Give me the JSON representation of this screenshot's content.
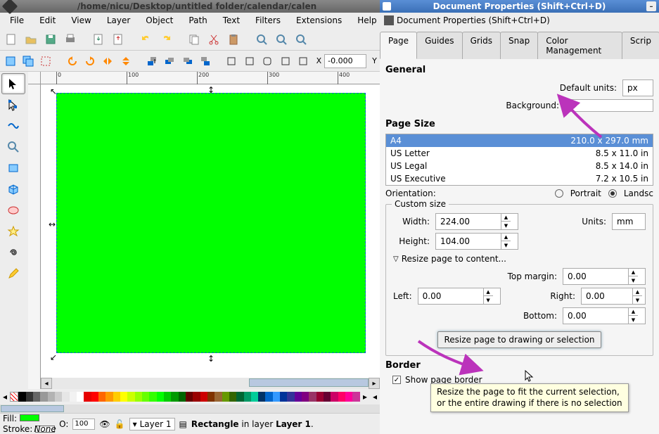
{
  "main_window": {
    "title": "/home/nicu/Desktop/untitled folder/calendar/calen",
    "menu": [
      "File",
      "Edit",
      "View",
      "Layer",
      "Object",
      "Path",
      "Text",
      "Filters",
      "Extensions",
      "Help"
    ],
    "coord_x_label": "X",
    "coord_x_value": "-0.000",
    "coord_y_label": "Y",
    "ruler_ticks": [
      "0",
      "100",
      "200",
      "300",
      "400"
    ]
  },
  "statusbar": {
    "fill_label": "Fill:",
    "stroke_label": "Stroke:",
    "stroke_value": "None",
    "opacity_label": "O:",
    "opacity_value": "100",
    "layer_value": "Layer 1",
    "status_prefix": "Rectangle",
    "status_mid1": " in layer ",
    "status_layer": "Layer 1",
    "status_suffix": ". "
  },
  "dialog": {
    "title": "Document Properties (Shift+Ctrl+D)",
    "subtitle": "Document Properties (Shift+Ctrl+D)",
    "tabs": [
      "Page",
      "Guides",
      "Grids",
      "Snap",
      "Color Management",
      "Scrip"
    ],
    "general_heading": "General",
    "default_units_label": "Default units:",
    "default_units_value": "px",
    "background_label": "Background:",
    "page_size_heading": "Page Size",
    "sizes": [
      {
        "name": "A4",
        "dim": "210.0 x 297.0 mm"
      },
      {
        "name": "US Letter",
        "dim": "8.5 x 11.0 in"
      },
      {
        "name": "US Legal",
        "dim": "8.5 x 14.0 in"
      },
      {
        "name": "US Executive",
        "dim": "7.2 x 10.5 in"
      }
    ],
    "orientation_label": "Orientation:",
    "portrait_label": "Portrait",
    "landscape_label": "Landsc",
    "custom_size_legend": "Custom size",
    "width_label": "Width:",
    "width_value": "224.00",
    "height_label": "Height:",
    "height_value": "104.00",
    "units_label": "Units:",
    "units_value": "mm",
    "resize_expand": "Resize page to content...",
    "top_margin_label": "Top margin:",
    "top_margin_value": "0.00",
    "left_label": "Left:",
    "left_value": "0.00",
    "right_label": "Right:",
    "right_value": "0.00",
    "bottom_label": "Bottom:",
    "bottom_value": "0.00",
    "resize_button": "Resize page to drawing or selection",
    "tooltip_l1": "Resize the page to fit the current selection,",
    "tooltip_l2": "or the entire drawing if there is no selection",
    "border_heading": "Border",
    "show_border_label": "Show page border"
  },
  "palette": [
    "#000000",
    "#333333",
    "#666666",
    "#999999",
    "#b3b3b3",
    "#cccccc",
    "#e6e6e6",
    "#f2f2f2",
    "#ffffff",
    "#e60000",
    "#ff0000",
    "#ff6600",
    "#ff9900",
    "#ffcc00",
    "#ffff00",
    "#ccff00",
    "#99ff00",
    "#66ff00",
    "#33ff00",
    "#00ff00",
    "#00cc00",
    "#009900",
    "#006600",
    "#660000",
    "#990000",
    "#cc0000",
    "#803300",
    "#996633",
    "#669900",
    "#336600",
    "#006633",
    "#009966",
    "#00cc99",
    "#003366",
    "#0066cc",
    "#3399ff",
    "#003399",
    "#333399",
    "#660099",
    "#800080",
    "#993366",
    "#990033",
    "#660033",
    "#cc0066",
    "#ff0066",
    "#ff0099",
    "#cc3399"
  ]
}
